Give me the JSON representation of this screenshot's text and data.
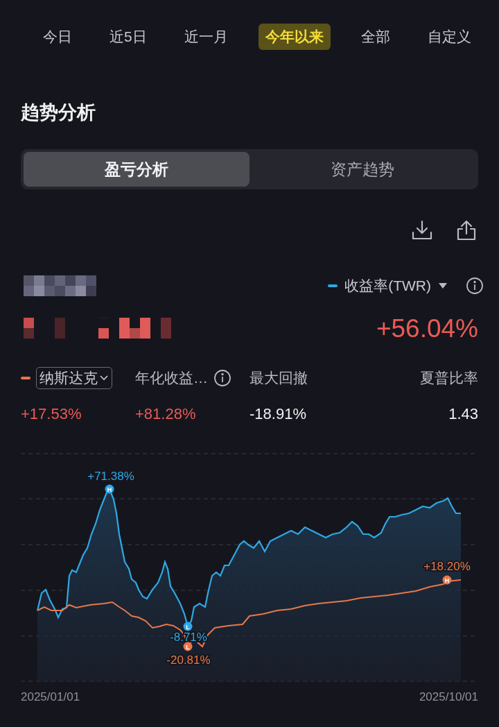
{
  "periods": [
    {
      "label": "今日",
      "selected": false
    },
    {
      "label": "近5日",
      "selected": false
    },
    {
      "label": "近一月",
      "selected": false
    },
    {
      "label": "今年以来",
      "selected": true
    },
    {
      "label": "全部",
      "selected": false
    },
    {
      "label": "自定义",
      "selected": false
    }
  ],
  "section_title": "趋势分析",
  "view_tabs": [
    {
      "label": "盈亏分析",
      "selected": true
    },
    {
      "label": "资产趋势",
      "selected": false
    }
  ],
  "metric": {
    "legend": "收益率(TWR)",
    "color": "#2fa8e6",
    "value": "+56.04%"
  },
  "stats": [
    {
      "kind": "benchmark",
      "label": "纳斯达克",
      "color": "#e8774a",
      "value": {
        "text": "+17.53%",
        "color": "#ec5a56"
      }
    },
    {
      "kind": "info",
      "label": "年化收益…",
      "value": {
        "text": "+81.28%",
        "color": "#ec5a56"
      }
    },
    {
      "kind": "plain",
      "label": "最大回撤",
      "value": {
        "text": "-18.91%",
        "color": "#f2f2f4"
      }
    },
    {
      "kind": "plain",
      "label": "夏普比率",
      "value": {
        "text": "1.43",
        "color": "#f2f2f4"
      }
    }
  ],
  "chart": {
    "annotations": [
      {
        "color": "#2fa8e6",
        "marker": "H",
        "label": "+71.38%"
      },
      {
        "color": "#2fa8e6",
        "marker": "L",
        "label": "-8.71%"
      },
      {
        "color": "#e8774a",
        "marker": "L",
        "label": "-20.81%"
      },
      {
        "color": "#e8774a",
        "marker": "H",
        "label": "+18.20%"
      }
    ],
    "x_start": "2025/01/01",
    "x_end": "2025/10/01"
  }
}
